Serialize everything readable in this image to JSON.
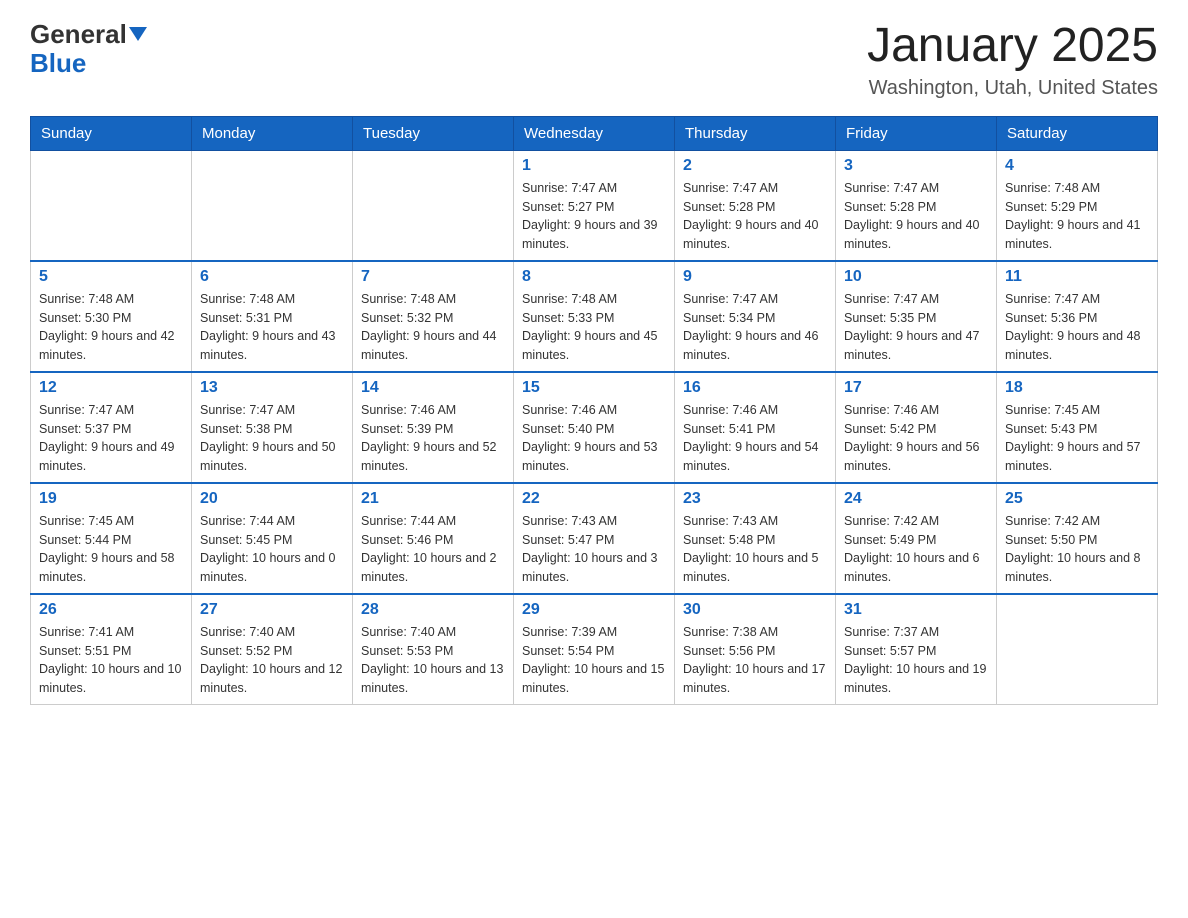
{
  "header": {
    "logo_general": "General",
    "logo_blue": "Blue",
    "main_title": "January 2025",
    "subtitle": "Washington, Utah, United States"
  },
  "days_of_week": [
    "Sunday",
    "Monday",
    "Tuesday",
    "Wednesday",
    "Thursday",
    "Friday",
    "Saturday"
  ],
  "weeks": [
    [
      {
        "day": "",
        "info": ""
      },
      {
        "day": "",
        "info": ""
      },
      {
        "day": "",
        "info": ""
      },
      {
        "day": "1",
        "info": "Sunrise: 7:47 AM\nSunset: 5:27 PM\nDaylight: 9 hours and 39 minutes."
      },
      {
        "day": "2",
        "info": "Sunrise: 7:47 AM\nSunset: 5:28 PM\nDaylight: 9 hours and 40 minutes."
      },
      {
        "day": "3",
        "info": "Sunrise: 7:47 AM\nSunset: 5:28 PM\nDaylight: 9 hours and 40 minutes."
      },
      {
        "day": "4",
        "info": "Sunrise: 7:48 AM\nSunset: 5:29 PM\nDaylight: 9 hours and 41 minutes."
      }
    ],
    [
      {
        "day": "5",
        "info": "Sunrise: 7:48 AM\nSunset: 5:30 PM\nDaylight: 9 hours and 42 minutes."
      },
      {
        "day": "6",
        "info": "Sunrise: 7:48 AM\nSunset: 5:31 PM\nDaylight: 9 hours and 43 minutes."
      },
      {
        "day": "7",
        "info": "Sunrise: 7:48 AM\nSunset: 5:32 PM\nDaylight: 9 hours and 44 minutes."
      },
      {
        "day": "8",
        "info": "Sunrise: 7:48 AM\nSunset: 5:33 PM\nDaylight: 9 hours and 45 minutes."
      },
      {
        "day": "9",
        "info": "Sunrise: 7:47 AM\nSunset: 5:34 PM\nDaylight: 9 hours and 46 minutes."
      },
      {
        "day": "10",
        "info": "Sunrise: 7:47 AM\nSunset: 5:35 PM\nDaylight: 9 hours and 47 minutes."
      },
      {
        "day": "11",
        "info": "Sunrise: 7:47 AM\nSunset: 5:36 PM\nDaylight: 9 hours and 48 minutes."
      }
    ],
    [
      {
        "day": "12",
        "info": "Sunrise: 7:47 AM\nSunset: 5:37 PM\nDaylight: 9 hours and 49 minutes."
      },
      {
        "day": "13",
        "info": "Sunrise: 7:47 AM\nSunset: 5:38 PM\nDaylight: 9 hours and 50 minutes."
      },
      {
        "day": "14",
        "info": "Sunrise: 7:46 AM\nSunset: 5:39 PM\nDaylight: 9 hours and 52 minutes."
      },
      {
        "day": "15",
        "info": "Sunrise: 7:46 AM\nSunset: 5:40 PM\nDaylight: 9 hours and 53 minutes."
      },
      {
        "day": "16",
        "info": "Sunrise: 7:46 AM\nSunset: 5:41 PM\nDaylight: 9 hours and 54 minutes."
      },
      {
        "day": "17",
        "info": "Sunrise: 7:46 AM\nSunset: 5:42 PM\nDaylight: 9 hours and 56 minutes."
      },
      {
        "day": "18",
        "info": "Sunrise: 7:45 AM\nSunset: 5:43 PM\nDaylight: 9 hours and 57 minutes."
      }
    ],
    [
      {
        "day": "19",
        "info": "Sunrise: 7:45 AM\nSunset: 5:44 PM\nDaylight: 9 hours and 58 minutes."
      },
      {
        "day": "20",
        "info": "Sunrise: 7:44 AM\nSunset: 5:45 PM\nDaylight: 10 hours and 0 minutes."
      },
      {
        "day": "21",
        "info": "Sunrise: 7:44 AM\nSunset: 5:46 PM\nDaylight: 10 hours and 2 minutes."
      },
      {
        "day": "22",
        "info": "Sunrise: 7:43 AM\nSunset: 5:47 PM\nDaylight: 10 hours and 3 minutes."
      },
      {
        "day": "23",
        "info": "Sunrise: 7:43 AM\nSunset: 5:48 PM\nDaylight: 10 hours and 5 minutes."
      },
      {
        "day": "24",
        "info": "Sunrise: 7:42 AM\nSunset: 5:49 PM\nDaylight: 10 hours and 6 minutes."
      },
      {
        "day": "25",
        "info": "Sunrise: 7:42 AM\nSunset: 5:50 PM\nDaylight: 10 hours and 8 minutes."
      }
    ],
    [
      {
        "day": "26",
        "info": "Sunrise: 7:41 AM\nSunset: 5:51 PM\nDaylight: 10 hours and 10 minutes."
      },
      {
        "day": "27",
        "info": "Sunrise: 7:40 AM\nSunset: 5:52 PM\nDaylight: 10 hours and 12 minutes."
      },
      {
        "day": "28",
        "info": "Sunrise: 7:40 AM\nSunset: 5:53 PM\nDaylight: 10 hours and 13 minutes."
      },
      {
        "day": "29",
        "info": "Sunrise: 7:39 AM\nSunset: 5:54 PM\nDaylight: 10 hours and 15 minutes."
      },
      {
        "day": "30",
        "info": "Sunrise: 7:38 AM\nSunset: 5:56 PM\nDaylight: 10 hours and 17 minutes."
      },
      {
        "day": "31",
        "info": "Sunrise: 7:37 AM\nSunset: 5:57 PM\nDaylight: 10 hours and 19 minutes."
      },
      {
        "day": "",
        "info": ""
      }
    ]
  ]
}
